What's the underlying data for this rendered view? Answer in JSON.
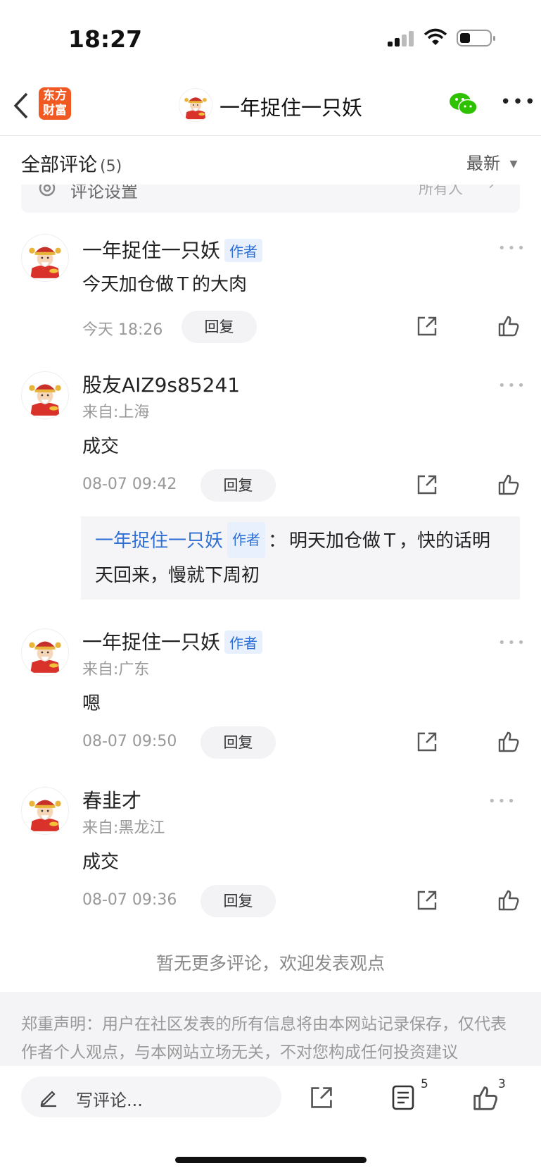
{
  "status": {
    "time": "18:27"
  },
  "nav": {
    "logo_line1": "东方",
    "logo_line2": "财富",
    "title": "一年捉住一只妖"
  },
  "header": {
    "all_comments": "全部评论",
    "count": "(5)",
    "sort": "最新"
  },
  "settings": {
    "label": "评论设置",
    "value": "所有人"
  },
  "comments": [
    {
      "name": "一年捉住一只妖",
      "badge": "作者",
      "from": "",
      "text": "今天加仓做Ｔ的大肉",
      "time": "今天 18:26",
      "reply": "回复"
    },
    {
      "name": "股友AIZ9s85241",
      "badge": "",
      "from": "来自:上海",
      "text": "成交",
      "time": "08-07 09:42",
      "reply": "回复",
      "quote": {
        "name": "一年捉住一只妖",
        "badge": "作者",
        "sep": "：",
        "text": "明天加仓做Ｔ，快的话明天回来，慢就下周初"
      }
    },
    {
      "name": "一年捉住一只妖",
      "badge": "作者",
      "from": "来自:广东",
      "text": "嗯",
      "time": "08-07 09:50",
      "reply": "回复"
    },
    {
      "name": "春韭才",
      "badge": "",
      "from": "来自:黑龙江",
      "text": "成交",
      "time": "08-07 09:36",
      "reply": "回复"
    }
  ],
  "no_more": "暂无更多评论，欢迎发表观点",
  "disclaimer": "郑重声明：用户在社区发表的所有信息将由本网站记录保存，仅代表作者个人观点，与本网站立场无关，不对您构成任何投资建议",
  "bottom": {
    "placeholder": "写评论...",
    "comment_count": "5",
    "like_count": "3"
  },
  "colors": {
    "accent": "#2e6fd6",
    "logo": "#f05a22",
    "wechat": "#2dc100"
  }
}
